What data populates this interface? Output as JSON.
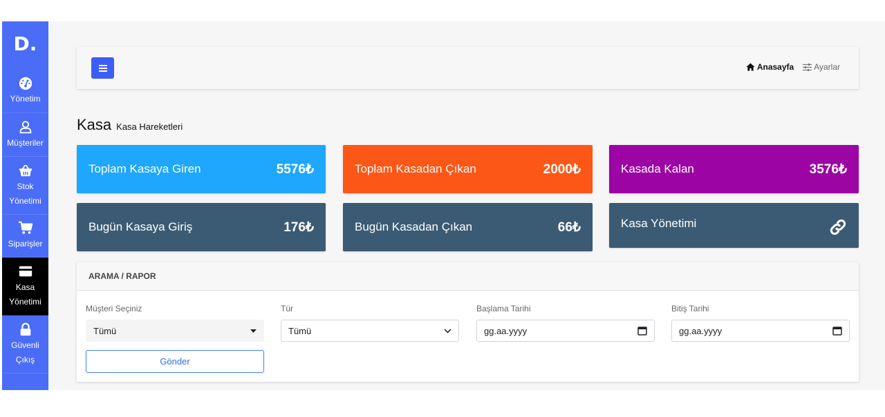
{
  "sidebar": {
    "logo": "D.",
    "items": [
      {
        "label": "Yönetim",
        "icon": "speedometer-icon"
      },
      {
        "label": "Müşteriler",
        "icon": "user-icon"
      },
      {
        "label": "Stok Yönetimi",
        "icon": "basket-icon"
      },
      {
        "label": "Siparişler",
        "icon": "cart-icon"
      },
      {
        "label": "Kasa Yönetimi",
        "icon": "credit-card-icon",
        "active": true
      },
      {
        "label": "Güvenli Çıkış",
        "icon": "lock-icon"
      }
    ]
  },
  "topbar": {
    "home_label": "Anasayfa",
    "settings_label": "Ayarlar"
  },
  "page": {
    "title": "Kasa",
    "subtitle": "Kasa Hareketleri"
  },
  "cards": [
    {
      "label": "Toplam Kasaya Giren",
      "value": "5576₺",
      "color": "#1ea7fd"
    },
    {
      "label": "Toplam Kasadan Çıkan",
      "value": "2000₺",
      "color": "#fd5717"
    },
    {
      "label": "Kasada Kalan",
      "value": "3576₺",
      "color": "#9c05a3"
    },
    {
      "label": "Bugün Kasaya Giriş",
      "value": "176₺",
      "color": "#3b5b74"
    },
    {
      "label": "Bugün Kasadan Çıkan",
      "value": "66₺",
      "color": "#3b5b74"
    },
    {
      "label": "Kasa Yönetimi",
      "icon": "link-icon",
      "color": "#3b5b74"
    }
  ],
  "search": {
    "title": "ARAMA / RAPOR",
    "customer_label": "Müşteri Seçiniz",
    "customer_value": "Tümü",
    "type_label": "Tür",
    "type_value": "Tümü",
    "start_label": "Başlama Tarihi",
    "start_placeholder": "gg.aa.yyyy",
    "end_label": "Bitiş Tarihi",
    "end_placeholder": "gg.aa.yyyy",
    "submit_label": "Gönder"
  }
}
